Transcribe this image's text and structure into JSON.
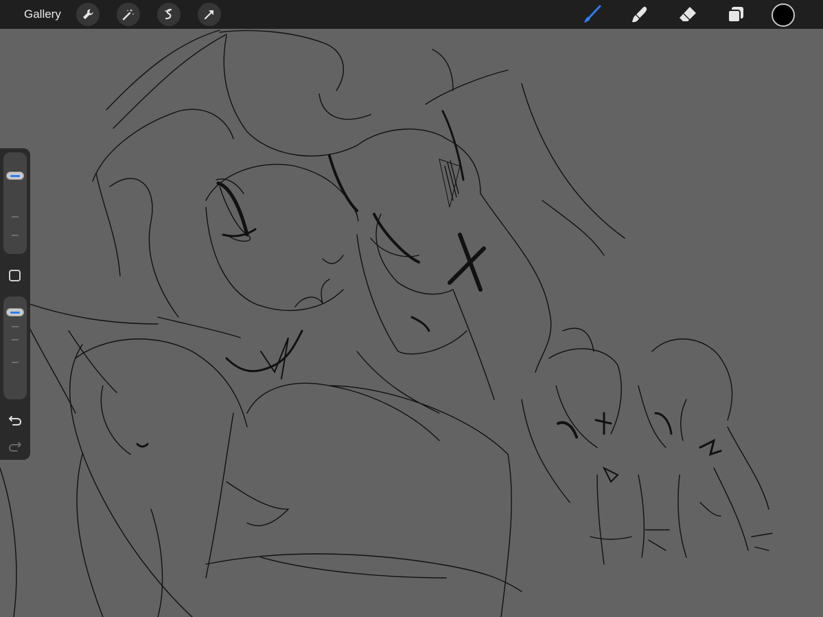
{
  "topbar": {
    "gallery_label": "Gallery",
    "left_tools": [
      "wrench-icon",
      "magic-wand-icon",
      "selection-icon",
      "transform-arrow-icon"
    ],
    "right_tools": [
      "brush-icon",
      "smudge-icon",
      "eraser-icon",
      "layers-icon"
    ],
    "active_tool": "brush-icon",
    "current_color": "#000000"
  },
  "sidebar": {
    "brush_size_level": 0.83,
    "opacity_level": 0.93,
    "icons": [
      "modifier-square-icon",
      "undo-icon",
      "redo-icon"
    ]
  },
  "colors": {
    "accent": "#2f7bf0",
    "canvas": "#636363",
    "toolbar": "#1f1f1f"
  }
}
